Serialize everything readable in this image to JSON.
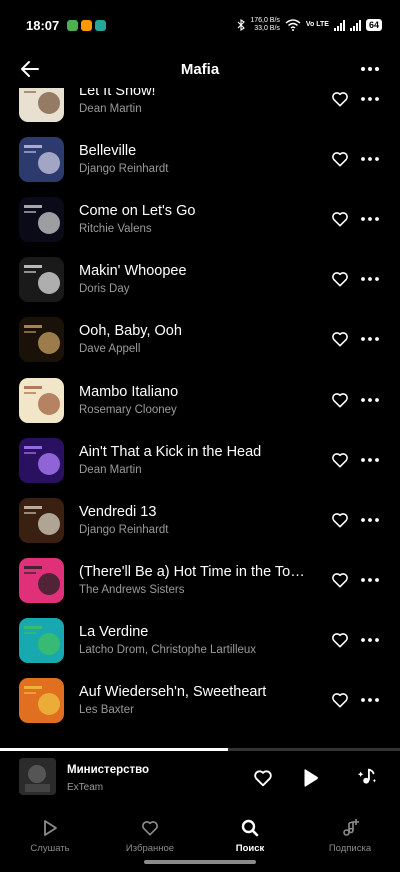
{
  "status_bar": {
    "time": "18:07",
    "net_up": "176,0 B/s",
    "net_down": "33,0 B/s",
    "volte": "Vo LTE",
    "battery": "64"
  },
  "header": {
    "title": "Mafia"
  },
  "tracks": [
    {
      "title": "Let It Snow!",
      "artist": "Dean Martin",
      "colors": [
        "#e8e0d0",
        "#7a5a40"
      ]
    },
    {
      "title": "Belleville",
      "artist": "Django Reinhardt",
      "colors": [
        "#2d3a6e",
        "#c9c9e0"
      ]
    },
    {
      "title": "Come on Let's Go",
      "artist": "Ritchie Valens",
      "colors": [
        "#0a0a18",
        "#d0d0d0"
      ]
    },
    {
      "title": "Makin' Whoopee",
      "artist": "Doris Day",
      "colors": [
        "#1a1a1a",
        "#e0e0e0"
      ]
    },
    {
      "title": "Ooh, Baby, Ooh",
      "artist": "Dave Appell",
      "colors": [
        "#1a1208",
        "#c8a060"
      ]
    },
    {
      "title": "Mambo Italiano",
      "artist": "Rosemary Clooney",
      "colors": [
        "#f2e6c8",
        "#a06040"
      ]
    },
    {
      "title": "Ain't That a Kick in the Head",
      "artist": "Dean Martin",
      "colors": [
        "#2a1060",
        "#b080ff"
      ]
    },
    {
      "title": "Vendredi 13",
      "artist": "Django Reinhardt",
      "colors": [
        "#3a2010",
        "#d8d0c0"
      ]
    },
    {
      "title": "(There'll Be a) Hot Time in the Town of Berlin",
      "artist": "The Andrews Sisters",
      "colors": [
        "#e0307a",
        "#202020"
      ]
    },
    {
      "title": "La Verdine",
      "artist": "Latcho Drom, Christophe Lartilleux",
      "colors": [
        "#18a8b0",
        "#40c060"
      ]
    },
    {
      "title": "Auf Wiederseh'n, Sweetheart",
      "artist": "Les Baxter",
      "colors": [
        "#e07020",
        "#f0c040"
      ]
    }
  ],
  "mini_player": {
    "title": "Министерство",
    "artist": "ExTeam",
    "progress": 0.57
  },
  "nav": {
    "tabs": [
      {
        "label": "Слушать",
        "icon": "play-outline-icon"
      },
      {
        "label": "Избранное",
        "icon": "heart-icon"
      },
      {
        "label": "Поиск",
        "icon": "search-icon"
      },
      {
        "label": "Подписка",
        "icon": "music-plus-icon"
      }
    ],
    "active_index": 2
  }
}
